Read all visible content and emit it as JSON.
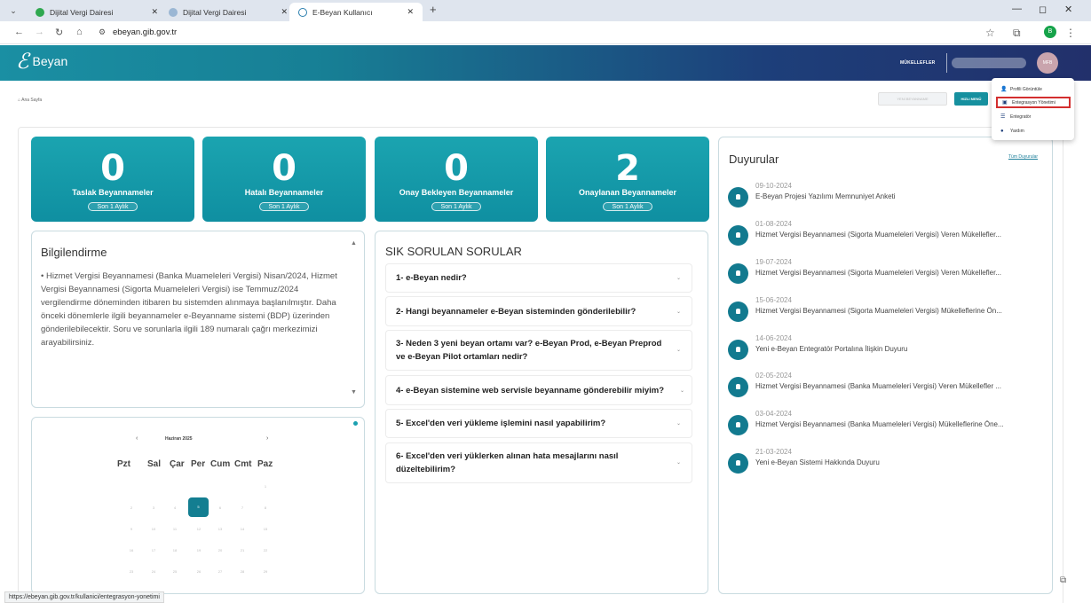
{
  "browser": {
    "tabs": [
      {
        "label": "Dijital Vergi Dairesi",
        "active": false
      },
      {
        "label": "Dijital Vergi Dairesi",
        "active": false
      },
      {
        "label": "E-Beyan Kullanıcı",
        "active": true
      }
    ],
    "url": "ebeyan.gib.gov.tr",
    "profile_initial": "B",
    "status_url": "https://ebeyan.gib.gov.tr/kullanici/entegrasyon-yonetimi"
  },
  "header": {
    "logo_text": "Beyan",
    "mukellef_label": "MÜKELLEFLER",
    "avatar_text": "MFB"
  },
  "breadcrumb": "Ana Sayfa",
  "actions": {
    "disabled_button": "YENİ BEYANNAME",
    "hizli_menu": "HIZLI MENÜ"
  },
  "dropdown": {
    "items": [
      {
        "label": "Profili Görüntüle",
        "icon": "user-icon"
      },
      {
        "label": "Entegrasyon Yönetimi",
        "icon": "integration-icon"
      },
      {
        "label": "Entegratör",
        "icon": "list-icon"
      },
      {
        "label": "Yardım",
        "icon": "help-icon"
      }
    ]
  },
  "stats": [
    {
      "value": "0",
      "label": "Taslak Beyannameler",
      "badge": "Son 1 Aylık"
    },
    {
      "value": "0",
      "label": "Hatalı Beyannameler",
      "badge": "Son 1 Aylık"
    },
    {
      "value": "0",
      "label": "Onay Bekleyen Beyannameler",
      "badge": "Son 1 Aylık"
    },
    {
      "value": "2",
      "label": "Onaylanan Beyannameler",
      "badge": "Son 1 Aylık"
    }
  ],
  "info": {
    "title": "Bilgilendirme",
    "text": "• Hizmet Vergisi Beyannamesi (Banka Muameleleri Vergisi) Nisan/2024, Hizmet Vergisi Beyannamesi (Sigorta Muameleleri Vergisi) ise Temmuz/2024 vergilendirme döneminden itibaren bu sistemden alınmaya başlanılmıştır. Daha önceki dönemlerle ilgili beyannameler e-Beyanname sistemi (BDP) üzerinden gönderilebilecektir. Soru ve sorunlarla ilgili 189 numaralı çağrı merkezimizi arayabilirsiniz."
  },
  "calendar": {
    "month": "Haziran 2025",
    "prev": "‹",
    "next": "›",
    "days": [
      "Pzt",
      "Sal",
      "Çar",
      "Per",
      "Cum",
      "Cmt",
      "Paz"
    ],
    "weeks": [
      [
        "",
        "",
        "",
        "",
        "",
        "",
        "1"
      ],
      [
        "2",
        "3",
        "4",
        "5",
        "6",
        "7",
        "8"
      ],
      [
        "9",
        "10",
        "11",
        "12",
        "13",
        "14",
        "15"
      ],
      [
        "16",
        "17",
        "18",
        "19",
        "20",
        "21",
        "22"
      ],
      [
        "23",
        "24",
        "25",
        "26",
        "27",
        "28",
        "29"
      ]
    ],
    "today": "5"
  },
  "faq": {
    "title": "SIK SORULAN SORULAR",
    "items": [
      {
        "q1": "1- e-Beyan nedir?",
        "q2": ""
      },
      {
        "q1": "2- Hangi beyannameler e-Beyan sisteminden gönderilebilir?",
        "q2": ""
      },
      {
        "q1": "3- Neden 3 yeni beyan ortamı var? e-Beyan Prod, e-Beyan Preprod",
        "q2": "ve e-Beyan Pilot ortamları nedir?"
      },
      {
        "q1": "4- e-Beyan sistemine web servisle beyanname gönderebilir miyim?",
        "q2": ""
      },
      {
        "q1": "5- Excel'den veri yükleme işlemini nasıl yapabilirim?",
        "q2": ""
      },
      {
        "q1": "6- Excel'den veri yüklerken alınan hata mesajlarını nasıl",
        "q2": "düzeltebilirim?"
      }
    ]
  },
  "duyurular": {
    "title": "Duyurular",
    "all_link": "Tüm Duyurular",
    "items": [
      {
        "date": "09-10-2024",
        "title": "E-Beyan Projesi Yazılımı Memnuniyet Anketi"
      },
      {
        "date": "01-08-2024",
        "title": "Hizmet Vergisi Beyannamesi (Sigorta Muameleleri Vergisi) Veren Mükellefler..."
      },
      {
        "date": "19-07-2024",
        "title": "Hizmet Vergisi Beyannamesi (Sigorta Muameleleri Vergisi) Veren Mükellefler..."
      },
      {
        "date": "15-06-2024",
        "title": "Hizmet Vergisi Beyannamesi (Sigorta Muameleleri Vergisi) Mükelleflerine Ön..."
      },
      {
        "date": "14-06-2024",
        "title": "Yeni e-Beyan Entegratör Portalına İlişkin Duyuru"
      },
      {
        "date": "02-05-2024",
        "title": "Hizmet Vergisi Beyannamesi (Banka Muameleleri Vergisi) Veren Mükellefler ..."
      },
      {
        "date": "03-04-2024",
        "title": "Hizmet Vergisi Beyannamesi (Banka Muameleleri Vergisi) Mükelleflerine Öne..."
      },
      {
        "date": "21-03-2024",
        "title": "Yeni e-Beyan Sistemi Hakkında Duyuru"
      }
    ]
  },
  "colors": {
    "primary": "#137e91",
    "header_start": "#1a8fa3",
    "header_end": "#22306b",
    "highlight": "#d32f2f"
  }
}
